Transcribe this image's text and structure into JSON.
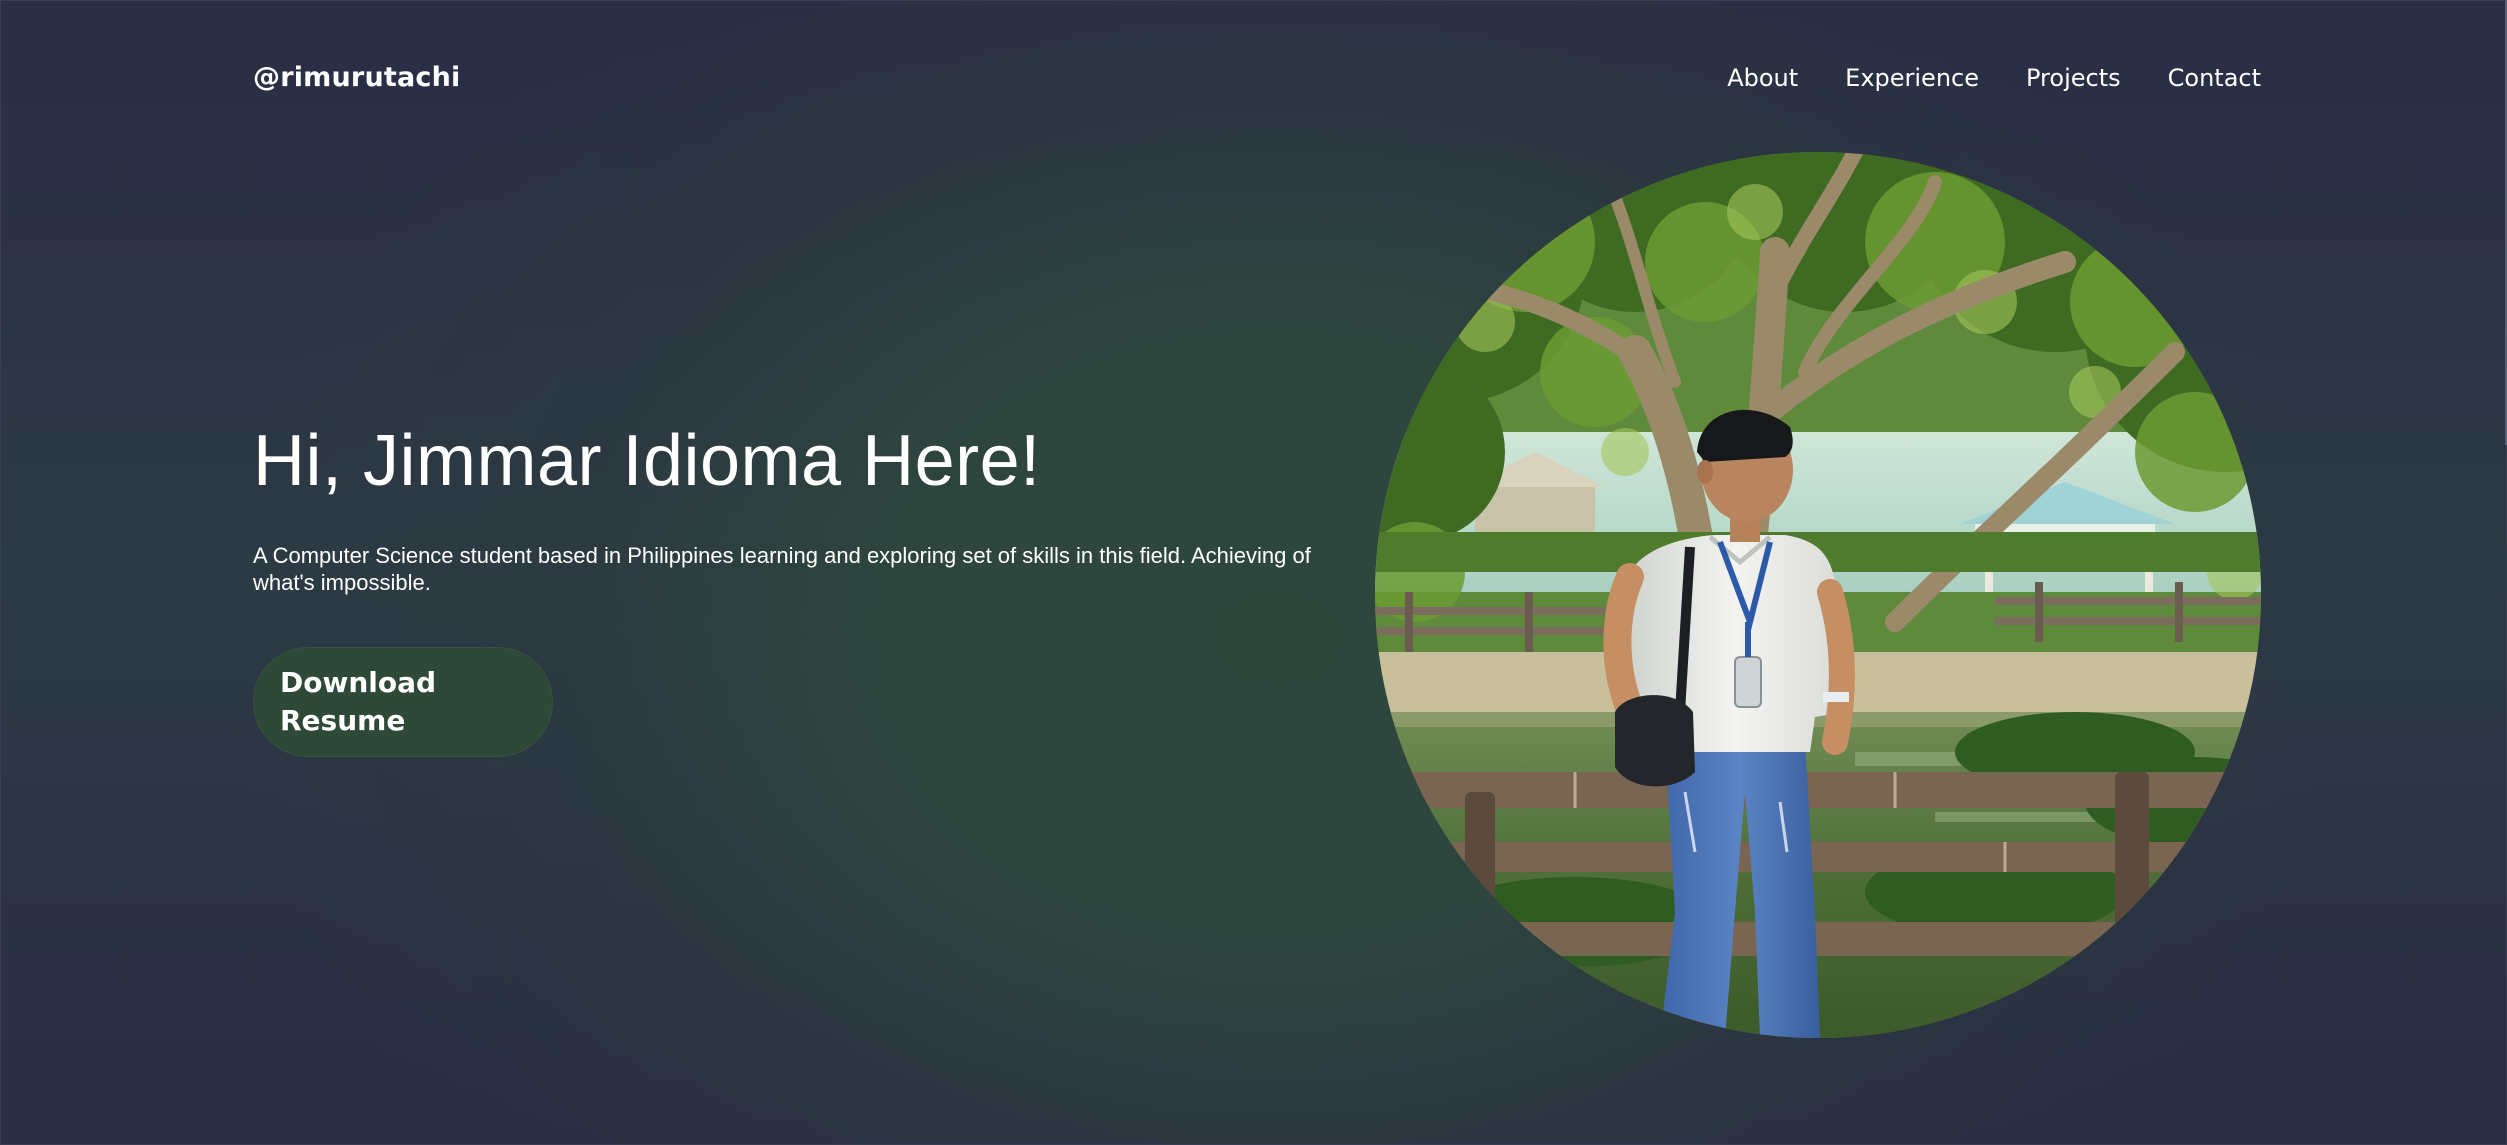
{
  "header": {
    "brand": "@rimurutachi",
    "nav": [
      {
        "label": "About"
      },
      {
        "label": "Experience"
      },
      {
        "label": "Projects"
      },
      {
        "label": "Contact"
      }
    ]
  },
  "hero": {
    "title": "Hi, Jimmar Idioma Here!",
    "description": "A Computer Science student based in Philippines learning and exploring set of skills in this field. Achieving of what's impossible.",
    "resume_button": "Download Resume"
  },
  "photo": {
    "subject": "profile-photo"
  },
  "colors": {
    "background": "#2b2d45",
    "glow": "#2e4a3e",
    "button": "#2e4937",
    "text": "#ffffff"
  }
}
